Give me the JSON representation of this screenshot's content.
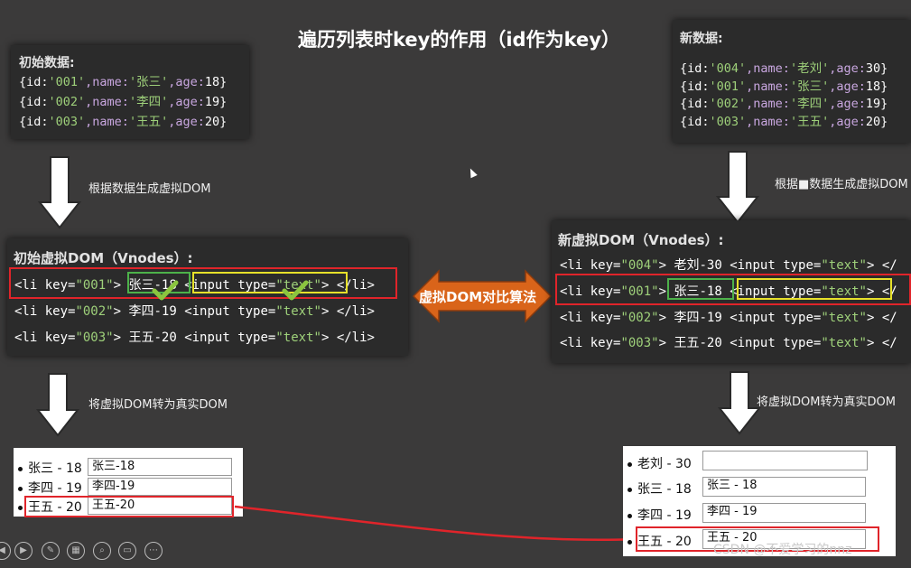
{
  "title": "遍历列表时key的作用（id作为key）",
  "initial_data": {
    "heading": "初始数据:",
    "rows": [
      {
        "p1": "{id:",
        "v1": "'001'",
        "p2": ",name:",
        "v2": "'张三'",
        "p3": ",age:",
        "v3": "18",
        "p4": "}"
      },
      {
        "p1": "{id:",
        "v1": "'002'",
        "p2": ",name:",
        "v2": "'李四'",
        "p3": ",age:",
        "v3": "19",
        "p4": "}"
      },
      {
        "p1": "{id:",
        "v1": "'003'",
        "p2": ",name:",
        "v2": "'王五'",
        "p3": ",age:",
        "v3": "20",
        "p4": "}"
      }
    ]
  },
  "new_data": {
    "heading": "新数据:",
    "rows": [
      {
        "p1": "{id:",
        "v1": "'004'",
        "p2": ",name:",
        "v2": "'老刘'",
        "p3": ",age:",
        "v3": "30",
        "p4": "}"
      },
      {
        "p1": "{id:",
        "v1": "'001'",
        "p2": ",name:",
        "v2": "'张三'",
        "p3": ",age:",
        "v3": "18",
        "p4": "}"
      },
      {
        "p1": "{id:",
        "v1": "'002'",
        "p2": ",name:",
        "v2": "'李四'",
        "p3": ",age:",
        "v3": "19",
        "p4": "}"
      },
      {
        "p1": "{id:",
        "v1": "'003'",
        "p2": ",name:",
        "v2": "'王五'",
        "p3": ",age:",
        "v3": "20",
        "p4": "}"
      }
    ]
  },
  "arrows": {
    "left_gen": "根据数据生成虚拟DOM",
    "right_gen": "根据■数据生成虚拟DOM",
    "left_real": "将虚拟DOM转为真实DOM",
    "right_real": "将虚拟DOM转为真实DOM"
  },
  "initial_vdom": {
    "heading": "初始虚拟DOM（Vnodes）:",
    "rows": [
      {
        "open": "<li key=",
        "key": "\"001\"",
        "close": ">",
        "text": "张三-18",
        "inp": "<input type=",
        "type": "\"text\"",
        "end": ">",
        "li_end": "</li>"
      },
      {
        "open": "<li key=",
        "key": "\"002\"",
        "close": ">",
        "text": "李四-19",
        "inp": "<input type=",
        "type": "\"text\"",
        "end": ">",
        "li_end": "</li>"
      },
      {
        "open": "<li key=",
        "key": "\"003\"",
        "close": ">",
        "text": "王五-20",
        "inp": "<input type=",
        "type": "\"text\"",
        "end": ">",
        "li_end": "</li>"
      }
    ]
  },
  "new_vdom": {
    "heading": "新虚拟DOM（Vnodes）:",
    "rows": [
      {
        "open": "<li key=",
        "key": "\"004\"",
        "close": ">",
        "text": "老刘-30",
        "inp": "<input type=",
        "type": "\"text\"",
        "end": ">",
        "li_end": "</"
      },
      {
        "open": "<li key=",
        "key": "\"001\"",
        "close": ">",
        "text": "张三-18",
        "inp": "<input type=",
        "type": "\"text\"",
        "end": ">",
        "li_end": "</"
      },
      {
        "open": "<li key=",
        "key": "\"002\"",
        "close": ">",
        "text": "李四-19",
        "inp": "<input type=",
        "type": "\"text\"",
        "end": ">",
        "li_end": "</"
      },
      {
        "open": "<li key=",
        "key": "\"003\"",
        "close": ">",
        "text": "王五-20",
        "inp": "<input type=",
        "type": "\"text\"",
        "end": ">",
        "li_end": "</"
      }
    ]
  },
  "compare_label": "虚拟DOM对比算法",
  "left_real": {
    "items": [
      {
        "label": "张三 - 18",
        "value": "张三-18"
      },
      {
        "label": "李四 - 19",
        "value": "李四-19"
      },
      {
        "label": "王五 - 20",
        "value": "王五-20"
      }
    ]
  },
  "right_real": {
    "items": [
      {
        "label": "老刘 - 30",
        "value": ""
      },
      {
        "label": "张三 - 18",
        "value": "张三 - 18"
      },
      {
        "label": "李四 - 19",
        "value": "李四 - 19"
      },
      {
        "label": "王五 - 20",
        "value": "王五 - 20"
      }
    ]
  },
  "watermark": "CSDN @不爱学习的nnz",
  "colors": {
    "background": "#3b3a3a",
    "panel": "#2b2b2b",
    "highlight_red": "#e0242a",
    "highlight_green": "#4db24a",
    "highlight_yellow": "#e7e12a",
    "compare_arrow": "#d9641a"
  }
}
